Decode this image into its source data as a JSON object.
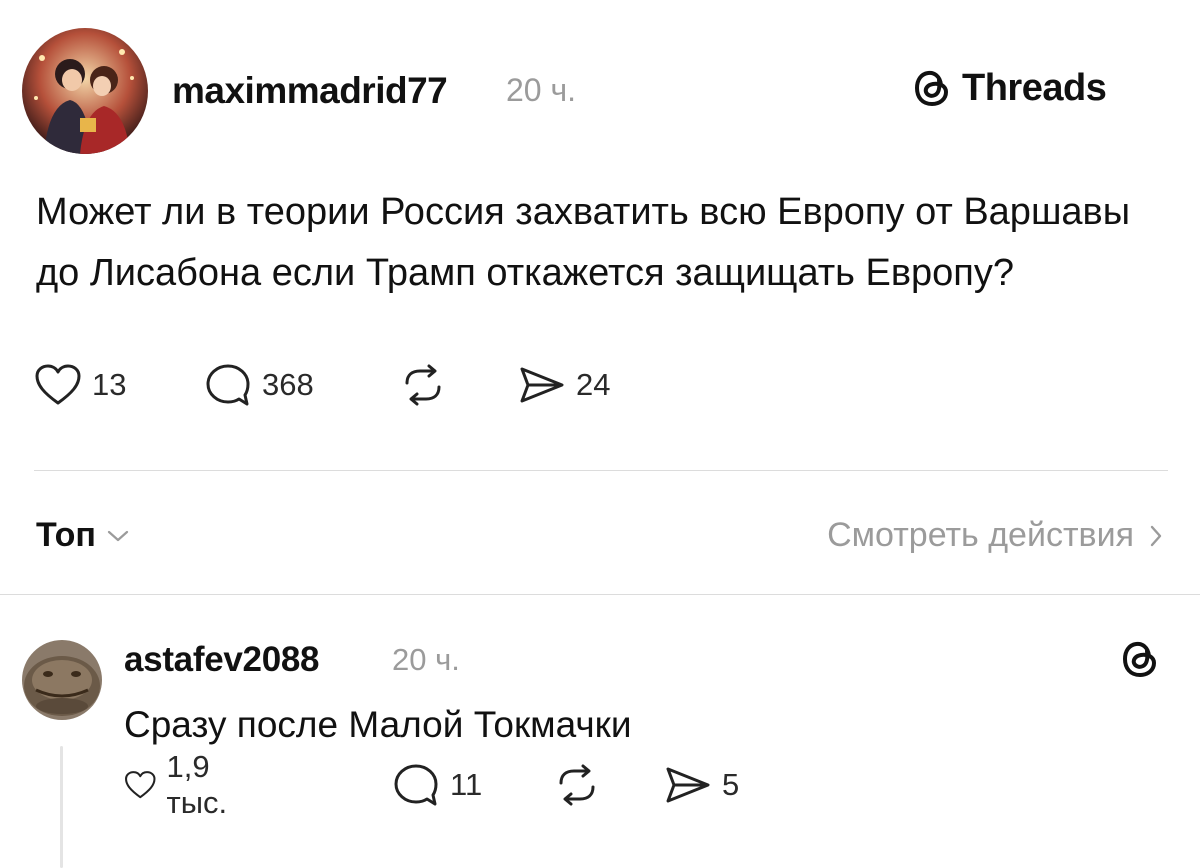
{
  "post": {
    "author": "maximmadrid77",
    "time": "20 ч.",
    "text": "Может ли в теории Россия захватить всю Европу от Варшавы до Лисабона если Трамп откажется защищать Европу?",
    "likes": "13",
    "replies": "368",
    "shares": "24",
    "avatar_icon": "avatar-couple-image"
  },
  "brand": {
    "name": "Threads",
    "icon": "threads-logo-icon"
  },
  "sort": {
    "label": "Топ",
    "icon": "chevron-down-icon"
  },
  "view_activity": {
    "label": "Смотреть действия",
    "icon": "chevron-right-icon"
  },
  "reply": {
    "author": "astafev2088",
    "time": "20 ч.",
    "text": "Сразу после Малой Токмачки",
    "likes": "1,9 тыс.",
    "replies": "11",
    "shares": "5",
    "avatar_icon": "avatar-creature-image"
  },
  "colors": {
    "text": "#111111",
    "muted": "#9b9b9b",
    "divider": "#dcdcdc"
  }
}
